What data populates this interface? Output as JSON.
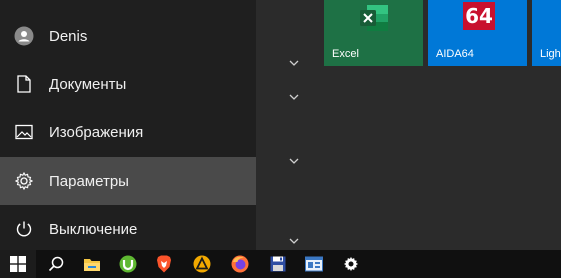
{
  "left_rail": {
    "user_name": "Denis",
    "documents_label": "Документы",
    "pictures_label": "Изображения",
    "settings_label": "Параметры",
    "power_label": "Выключение"
  },
  "tiles": [
    {
      "label": "Excel",
      "color": "#1e7145"
    },
    {
      "label": "AIDA64",
      "color": "#0078d7",
      "logo_text": "64"
    },
    {
      "label": "Ligh",
      "color": "#0078d7"
    }
  ],
  "taskbar": {
    "icons": [
      "windows-start-icon",
      "search-icon",
      "file-explorer-icon",
      "utorrent-icon",
      "brave-icon",
      "aimp-icon",
      "firefox-icon",
      "floppy-save-icon",
      "control-panel-icon",
      "settings-gear-icon"
    ]
  },
  "colors": {
    "rail_bg": "#1f1f1f",
    "rail_active": "#4a4a4a",
    "excel_green": "#1e7145",
    "aida_blue": "#0078d7",
    "taskbar_bg": "#101010"
  }
}
